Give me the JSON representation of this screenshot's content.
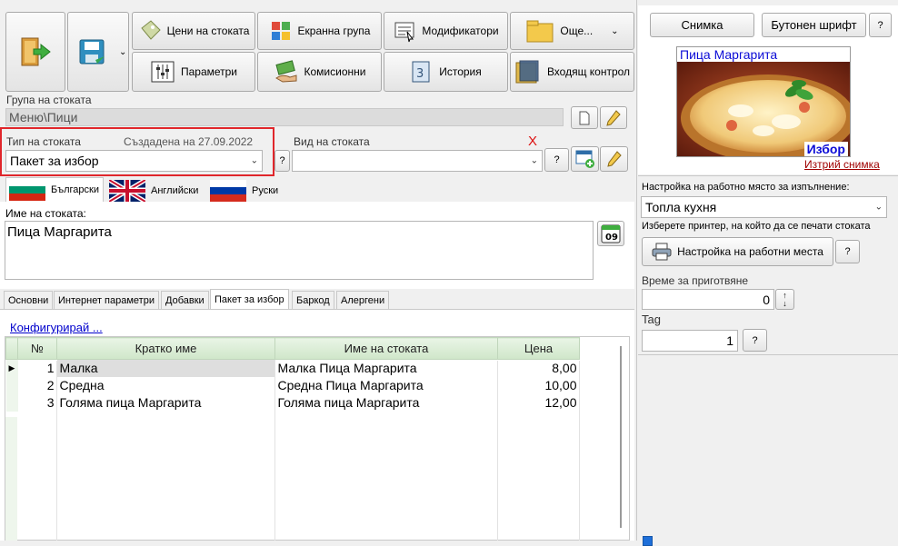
{
  "toolbar": {
    "price_label": "Цени на стоката",
    "screen_group_label": "Екранна група",
    "modifiers_label": "Модификатори",
    "more_label": "Още...",
    "params_label": "Параметри",
    "commissions_label": "Комисионни",
    "history_label": "История",
    "incoming_control_label": "Входящ контрол"
  },
  "group": {
    "label": "Група на стоката",
    "value": "Меню\\Пици"
  },
  "type": {
    "label": "Тип на стоката",
    "created": "Създадена на 27.09.2022",
    "value": "Пакет за избор",
    "help": "?"
  },
  "kind": {
    "label": "Вид на стоката",
    "clear": "X",
    "value": "",
    "help": "?"
  },
  "languages": [
    "Български",
    "Английски",
    "Руски"
  ],
  "name": {
    "label": "Име на стоката:",
    "value": "Пица Маргарита",
    "calendar_day": "09"
  },
  "tabs": [
    "Основни",
    "Интернет параметри",
    "Добавки",
    "Пакет за избор",
    "Баркод",
    "Алергени"
  ],
  "configure_link": "Конфигурирай ...",
  "table": {
    "headers": [
      "№",
      "Кратко име",
      "Име на стоката",
      "Цена"
    ],
    "rows": [
      {
        "n": "1",
        "short": "Малка",
        "name": "Малка Пица Маргарита",
        "price": "8,00"
      },
      {
        "n": "2",
        "short": "Средна",
        "name": "Средна Пица Маргарита",
        "price": "10,00"
      },
      {
        "n": "3",
        "short": "Голяма пица Маргарита",
        "name": "Голяма пица Маргарита",
        "price": "12,00"
      }
    ]
  },
  "right": {
    "picture_button": "Снимка",
    "font_button": "Бутонен шрифт",
    "help": "?",
    "image_title": "Пица Маргарита",
    "image_badge": "Избор",
    "delete_picture": "Изтрий снимка",
    "workplace_label": "Настройка на работно място за изпълнение:",
    "workplace_value": "Топла кухня",
    "printer_label": "Изберете принтер, на който да се печати стоката",
    "workplace_settings": "Настройка на работни места",
    "prep_label": "Време за приготвяне",
    "prep_value": "0",
    "tag_label": "Tag",
    "tag_value": "1"
  },
  "colors": {
    "highlight": "#e0262b",
    "link": "#0000cc",
    "grid_header": "#d6ead1",
    "badge_text": "#0b0bd6"
  }
}
